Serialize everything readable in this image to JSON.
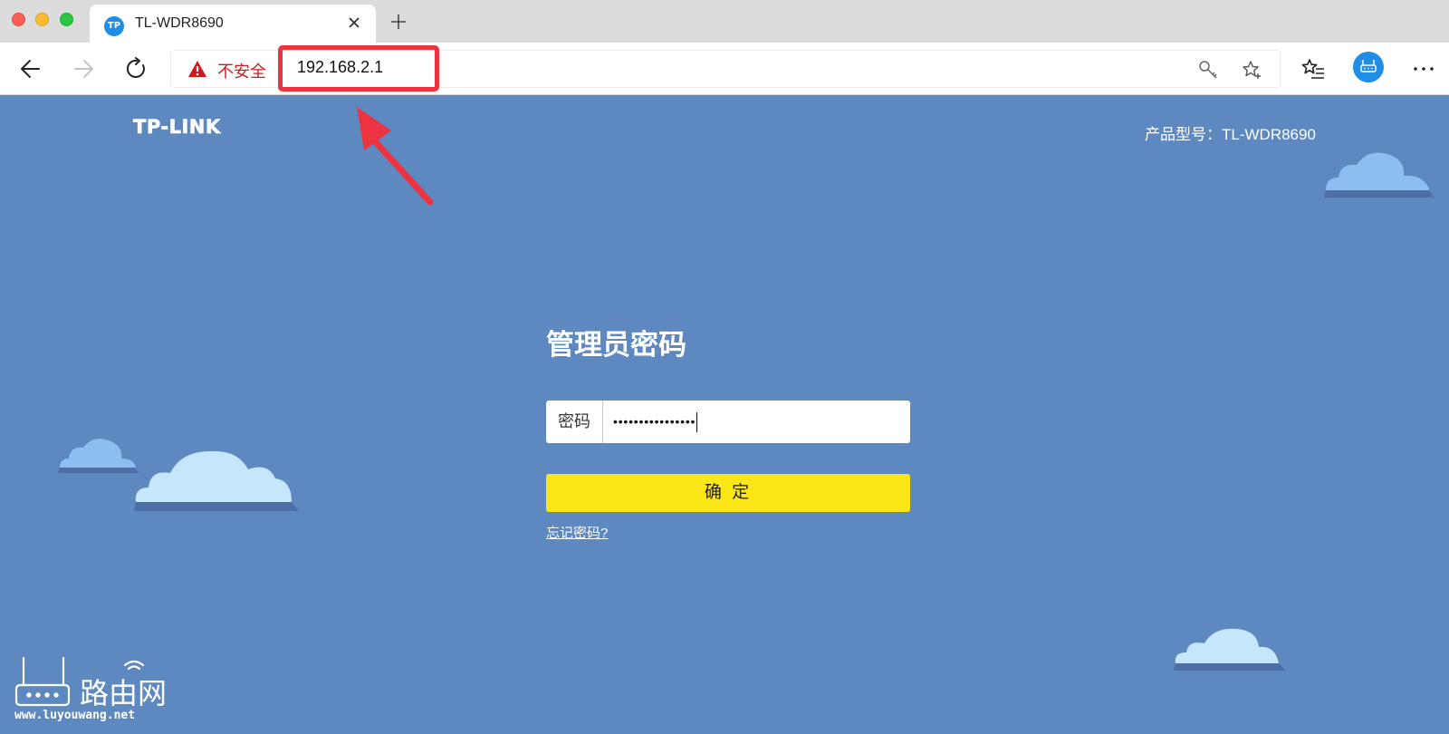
{
  "browser": {
    "tab": {
      "title": "TL-WDR8690",
      "favicon_text": "TP"
    },
    "address": {
      "security_label": "不安全",
      "url": "192.168.2.1"
    }
  },
  "page": {
    "logo": "TP-LINK",
    "model_label": "产品型号：TL-WDR8690",
    "form": {
      "title": "管理员密码",
      "password_label": "密码",
      "password_value": "••••••••••••••••",
      "submit_label": "确 定",
      "forgot_link": "忘记密码?"
    }
  },
  "watermark": {
    "brand": "路由网",
    "url": "www.luyouwang.net"
  },
  "colors": {
    "page_background": "#5e88c0",
    "submit_button": "#fbe617",
    "url_highlight": "#ee3340",
    "insecure_text": "#c5221f",
    "accent": "#1f8ee6"
  },
  "icons": [
    "back-arrow-icon",
    "forward-arrow-icon",
    "reload-icon",
    "warning-icon",
    "key-icon",
    "add-favorite-icon",
    "favorites-icon",
    "profile-icon",
    "more-icon",
    "tab-close-icon",
    "new-tab-icon"
  ]
}
